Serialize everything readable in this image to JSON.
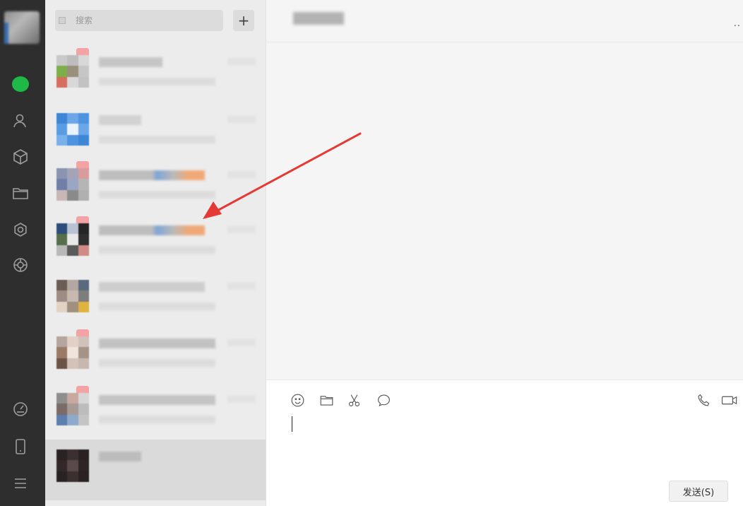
{
  "search": {
    "placeholder": "搜索",
    "add_label": "+"
  },
  "chat": {
    "more_label": "..",
    "send_label": "发送(S)"
  },
  "colors": {
    "rail": "#2e2e2e",
    "chat_active": "#1fb947",
    "annotation_arrow": "#e53935"
  },
  "icons": {
    "rail": [
      "user-avatar",
      "chat-icon",
      "contacts-icon",
      "cube-icon",
      "folder-icon",
      "mini-program-icon",
      "moments-icon",
      "disk-icon",
      "phone-icon",
      "menu-icon"
    ],
    "toolbar": [
      "emoji-icon",
      "file-icon",
      "screenshot-icon",
      "chat-history-icon",
      "voice-call-icon",
      "video-call-icon"
    ]
  }
}
